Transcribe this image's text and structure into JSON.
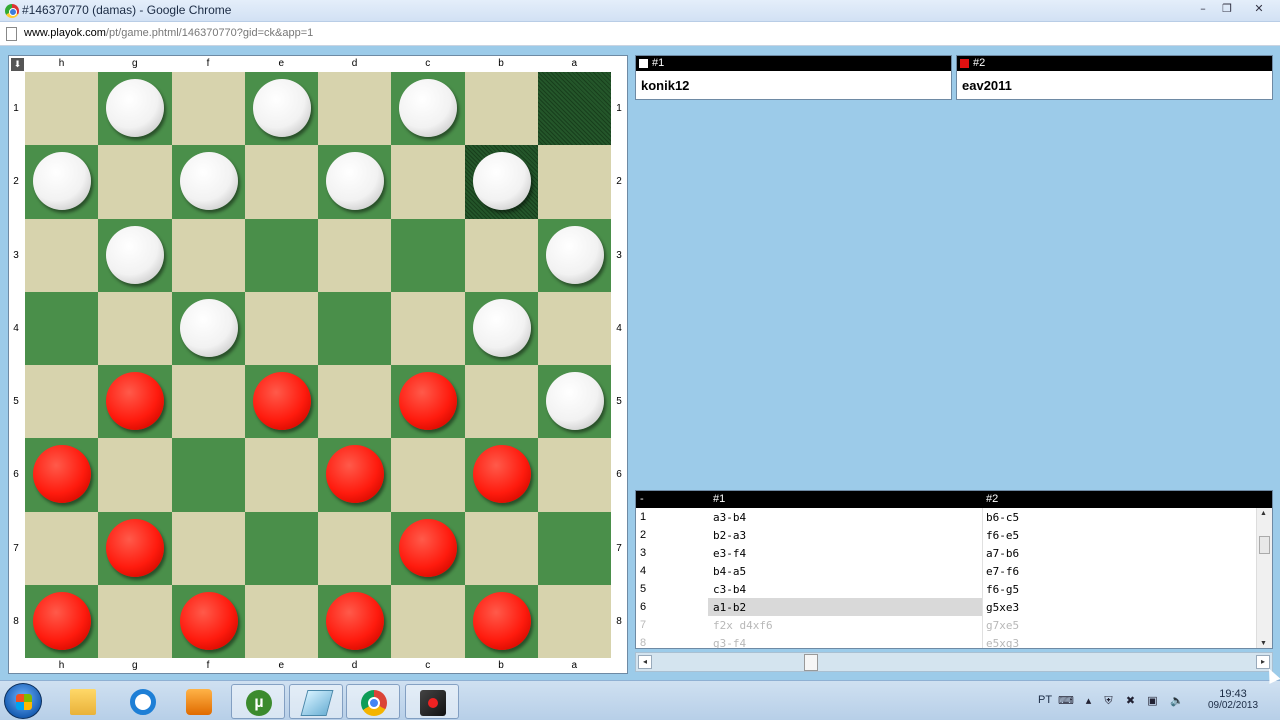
{
  "window": {
    "title": "#146370770 (damas) - Google Chrome",
    "min_label": "–",
    "max_label": "❐",
    "close_label": "✕"
  },
  "address": {
    "host": "www.playok.com",
    "path": "/pt/game.phtml/146370770?gid=ck&app=1"
  },
  "board": {
    "corner_label": "⬇",
    "files": [
      "h",
      "g",
      "f",
      "e",
      "d",
      "c",
      "b",
      "a"
    ],
    "ranks": [
      "1",
      "2",
      "3",
      "4",
      "5",
      "6",
      "7",
      "8"
    ],
    "light_color": "#d7d3ad",
    "dark_color": "#4a8f4a",
    "white_pieces": [
      "g1",
      "e1",
      "c1",
      "h2",
      "f2",
      "d2",
      "b2",
      "g3",
      "a3",
      "f4",
      "b4",
      "a5"
    ],
    "red_pieces": [
      "g5",
      "e5",
      "c5",
      "h6",
      "d6",
      "b6",
      "g7",
      "c7",
      "h8",
      "f8",
      "d8",
      "b8"
    ],
    "highlighted": [
      "a1",
      "b2"
    ]
  },
  "players": [
    {
      "seat": "#1",
      "color": "#ffffff",
      "name": "konik12"
    },
    {
      "seat": "#2",
      "color": "#e11010",
      "name": "eav2011"
    }
  ],
  "moves": {
    "headers": [
      "-",
      "#1",
      "#2"
    ],
    "rows": [
      {
        "n": "1",
        "w": "a3-b4",
        "b": "b6-c5",
        "state": "played"
      },
      {
        "n": "2",
        "w": "b2-a3",
        "b": "f6-e5",
        "state": "played"
      },
      {
        "n": "3",
        "w": "e3-f4",
        "b": "a7-b6",
        "state": "played"
      },
      {
        "n": "4",
        "w": "b4-a5",
        "b": "e7-f6",
        "state": "played"
      },
      {
        "n": "5",
        "w": "c3-b4",
        "b": "f6-g5",
        "state": "played"
      },
      {
        "n": "6",
        "w": "a1-b2",
        "b": "g5xe3",
        "state": "current"
      },
      {
        "n": "7",
        "w": "f2x d4xf6",
        "b": "g7xe5",
        "state": "future"
      },
      {
        "n": "8",
        "w": "g3-f4",
        "b": "e5xg3",
        "state": "future"
      }
    ]
  },
  "taskbar": {
    "language": "PT",
    "time": "19:43",
    "date": "09/02/2013",
    "apps": [
      "folder-icon",
      "ie-icon",
      "media-player-icon",
      "utorrent-icon",
      "app-icon",
      "chrome-icon",
      "checkers-game-icon"
    ],
    "utorrent_glyph": "µ"
  }
}
